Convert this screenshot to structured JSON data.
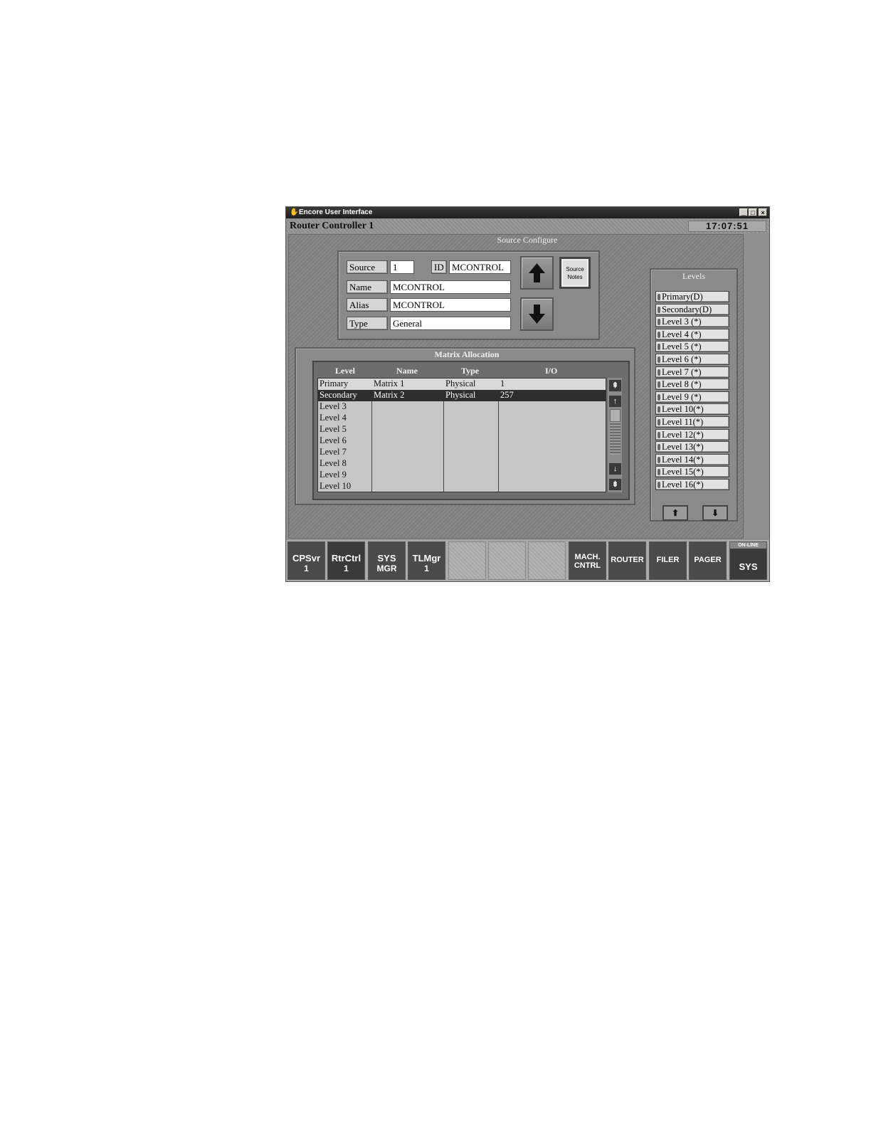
{
  "window": {
    "title": "Encore User Interface",
    "controls": [
      "_",
      "□",
      "×"
    ]
  },
  "header": {
    "title": "Router Controller  1",
    "clock": "17:07:51"
  },
  "source_configure": {
    "section_title": "Source Configure",
    "source_label": "Source",
    "source_value": "1",
    "id_label": "ID",
    "id_value": "MCONTROL",
    "name_label": "Name",
    "name_value": "MCONTROL",
    "alias_label": "Alias",
    "alias_value": "MCONTROL",
    "type_label": "Type",
    "type_value": "General",
    "up_arrow": "up-arrow-icon",
    "down_arrow": "down-arrow-icon",
    "notes_line1": "Source",
    "notes_line2": "Notes"
  },
  "matrix": {
    "section_title": "Matrix Allocation",
    "columns": [
      "Level",
      "Name",
      "Type",
      "I/O"
    ],
    "rows": [
      {
        "level": "Primary",
        "name": "Matrix  1",
        "type": "Physical",
        "io": "1"
      },
      {
        "level": "Secondary",
        "name": "Matrix  2",
        "type": "Physical",
        "io": "257"
      },
      {
        "level": "Level 3",
        "name": "",
        "type": "",
        "io": ""
      },
      {
        "level": "Level 4",
        "name": "",
        "type": "",
        "io": ""
      },
      {
        "level": "Level 5",
        "name": "",
        "type": "",
        "io": ""
      },
      {
        "level": "Level 6",
        "name": "",
        "type": "",
        "io": ""
      },
      {
        "level": "Level 7",
        "name": "",
        "type": "",
        "io": ""
      },
      {
        "level": "Level 8",
        "name": "",
        "type": "",
        "io": ""
      },
      {
        "level": "Level 9",
        "name": "",
        "type": "",
        "io": ""
      },
      {
        "level": "Level 10",
        "name": "",
        "type": "",
        "io": ""
      }
    ],
    "selected_row": 1
  },
  "levels": {
    "title": "Levels",
    "items": [
      "Primary(D)",
      "Secondary(D)",
      "Level 3 (*)",
      "Level 4 (*)",
      "Level 5 (*)",
      "Level 6 (*)",
      "Level 7 (*)",
      "Level 8 (*)",
      "Level 9 (*)",
      "Level 10(*)",
      "Level 11(*)",
      "Level 12(*)",
      "Level 13(*)",
      "Level 14(*)",
      "Level 15(*)",
      "Level 16(*)"
    ]
  },
  "bottom_bar": {
    "cpsvr": {
      "l1": "CPSvr",
      "l2": "1"
    },
    "rtrctrl": {
      "l1": "RtrCtrl",
      "l2": "1"
    },
    "sysmgr": {
      "l1": "SYS",
      "l2": "MGR"
    },
    "tlmgr": {
      "l1": "TLMgr",
      "l2": "1"
    },
    "machcntrl": {
      "l1": "MACH.",
      "l2": "CNTRL"
    },
    "router": "ROUTER",
    "filer": "FILER",
    "pager": "PAGER",
    "sys": {
      "status": "ON-LINE",
      "label": "SYS"
    }
  }
}
